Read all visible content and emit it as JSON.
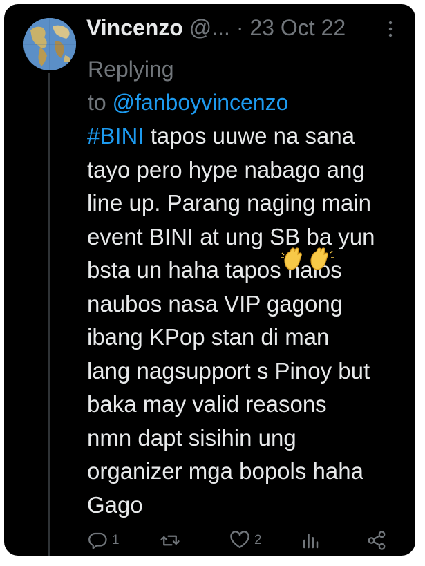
{
  "tweet": {
    "display_name": "Vincenzo",
    "handle_truncated": "@...",
    "separator": "·",
    "date": "23 Oct 22",
    "replying_prefix": "Replying",
    "replying_to_word": "to",
    "replying_handle": "@fanboyvincenzo",
    "hashtag": "#BINI",
    "body_lines": [
      " tapos uuwe na sana",
      "tayo pero hype nabago ang",
      "line up. Parang naging main",
      "event BINI at ung SB ba yun",
      "bsta un haha tapos halos",
      "naubos nasa VIP gagong",
      "ibang KPop stan di man",
      "lang nagsupport s Pinoy but",
      "baka may valid reasons",
      "nmn dapt sisihin ung",
      "organizer mga bopols haha",
      "Gago"
    ]
  },
  "actions": {
    "reply_count": "1",
    "retweet_count": "",
    "like_count": "2",
    "views_count": ""
  },
  "icons": {
    "avatar": "world-map-avatar",
    "more": "more-options-icon",
    "emoji": "raising-hands-emoji",
    "reply": "reply-icon",
    "retweet": "retweet-icon",
    "like": "heart-icon",
    "views": "analytics-icon",
    "share": "share-icon"
  },
  "colors": {
    "background": "#000000",
    "primary_text": "#e7e9ea",
    "secondary_text": "#71767b",
    "accent": "#1d9bf0",
    "thread_line": "#2f3336"
  }
}
